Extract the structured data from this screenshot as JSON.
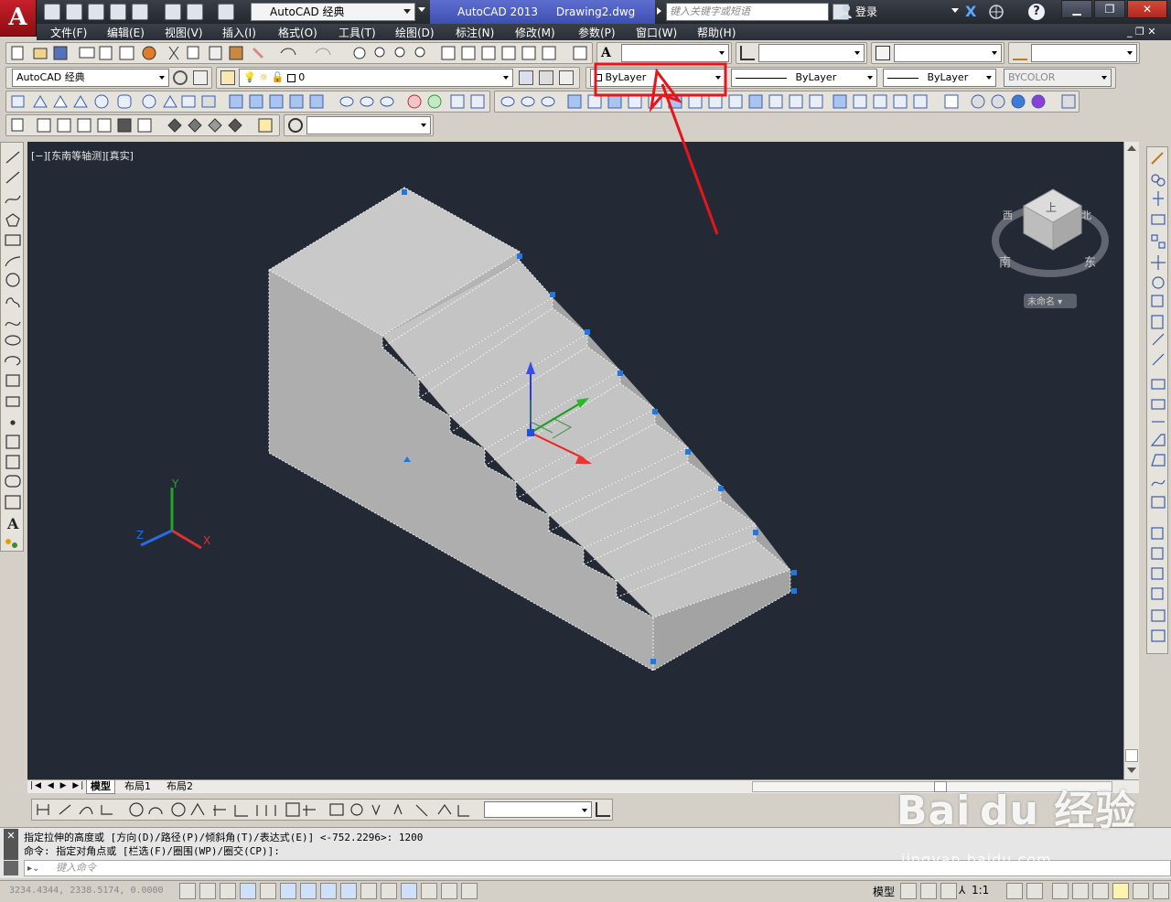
{
  "titlebar": {
    "workspace": "AutoCAD 经典",
    "app_title": "AutoCAD 2013",
    "document": "Drawing2.dwg",
    "search_placeholder": "键入关键字或短语",
    "login": "登录"
  },
  "menu": [
    "文件(F)",
    "编辑(E)",
    "视图(V)",
    "插入(I)",
    "格式(O)",
    "工具(T)",
    "绘图(D)",
    "标注(N)",
    "修改(M)",
    "参数(P)",
    "窗口(W)",
    "帮助(H)"
  ],
  "layers": {
    "workspace_combo": "AutoCAD 经典",
    "layer_name": "0",
    "color": "ByLayer",
    "linetype": "ByLayer",
    "lineweight": "ByLayer",
    "plotstyle": "BYCOLOR"
  },
  "viewport": {
    "label": "[−][东南等轴测][真实]",
    "viewcube_top": "上",
    "viewcube_south": "南",
    "viewcube_east": "东",
    "viewcube_west": "西",
    "viewcube_north": "北",
    "viewcube_unnamed": "未命名 ▾",
    "ucs_x": "X",
    "ucs_y": "Y",
    "ucs_z": "Z"
  },
  "tabs": [
    "模型",
    "布局1",
    "布局2"
  ],
  "command": {
    "line1": "指定拉伸的高度或 [方向(D)/路径(P)/倾斜角(T)/表达式(E)] <-752.2296>: 1200",
    "line2": "命令: 指定对角点或 [栏选(F)/圈围(WP)/圈交(CP)]:",
    "placeholder": "键入命令"
  },
  "status": {
    "coords": "3234.4344, 2338.5174, 0.0000",
    "model": "模型",
    "scale": "1:1"
  },
  "watermark": {
    "brand": "Bai du 经验",
    "url": "jingyan.baidu.com"
  },
  "colors": {
    "highlight": "#e8141c",
    "grip": "#1e78e0",
    "viewport_bg": "#242a35"
  }
}
